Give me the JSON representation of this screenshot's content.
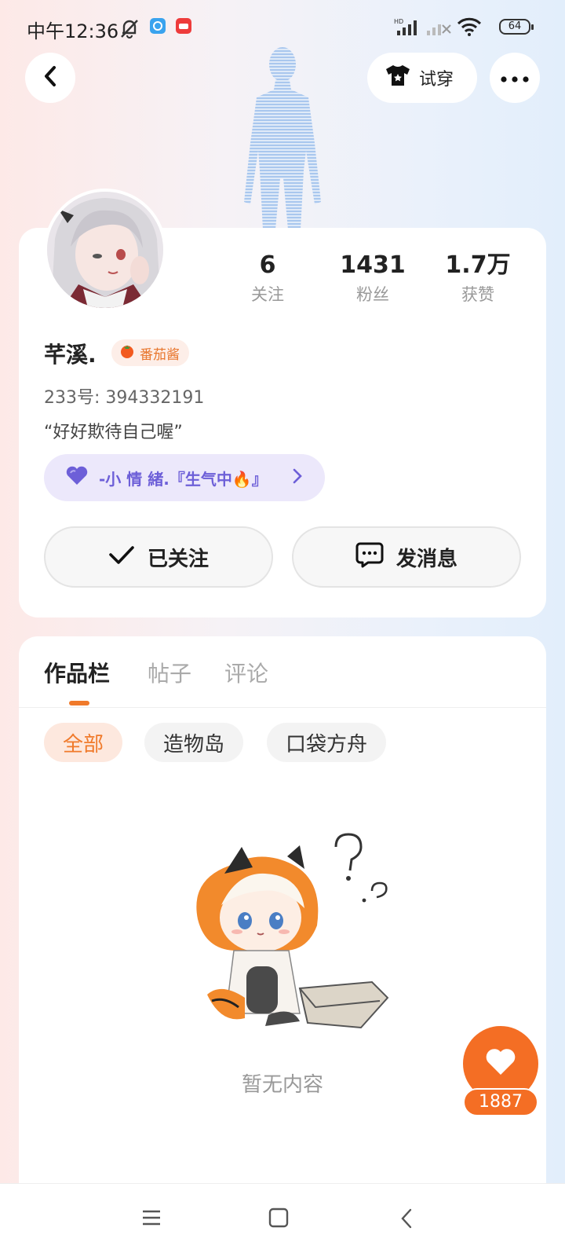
{
  "status_bar": {
    "time": "中午12:36",
    "battery": "64",
    "icons": [
      "mute-bell-icon",
      "app-notification-icon",
      "app-notification-icon",
      "hd-signal-icon",
      "no-signal-icon",
      "wifi-icon",
      "battery-icon"
    ]
  },
  "header": {
    "try_on_label": "试穿"
  },
  "profile": {
    "username": "芊溪.",
    "badge_label": "番茄酱",
    "uid_line": "233号: 394332191",
    "motto": "“好好欺待自己喔”",
    "mood_label": "-小 情 緒.『生气中🔥』",
    "stats": [
      {
        "value": "6",
        "label": "关注"
      },
      {
        "value": "1431",
        "label": "粉丝"
      },
      {
        "value": "1.7万",
        "label": "获赞"
      }
    ],
    "follow_button": "已关注",
    "message_button": "发消息"
  },
  "works": {
    "tabs": [
      "作品栏",
      "帖子",
      "评论"
    ],
    "active_tab": 0,
    "filters": [
      "全部",
      "造物岛",
      "口袋方舟"
    ],
    "active_filter": 0,
    "empty_text": "暂无内容"
  },
  "like_fab": {
    "count": "1887"
  },
  "colors": {
    "accent": "#f46e24",
    "mood_purple": "#6d5fd8"
  }
}
